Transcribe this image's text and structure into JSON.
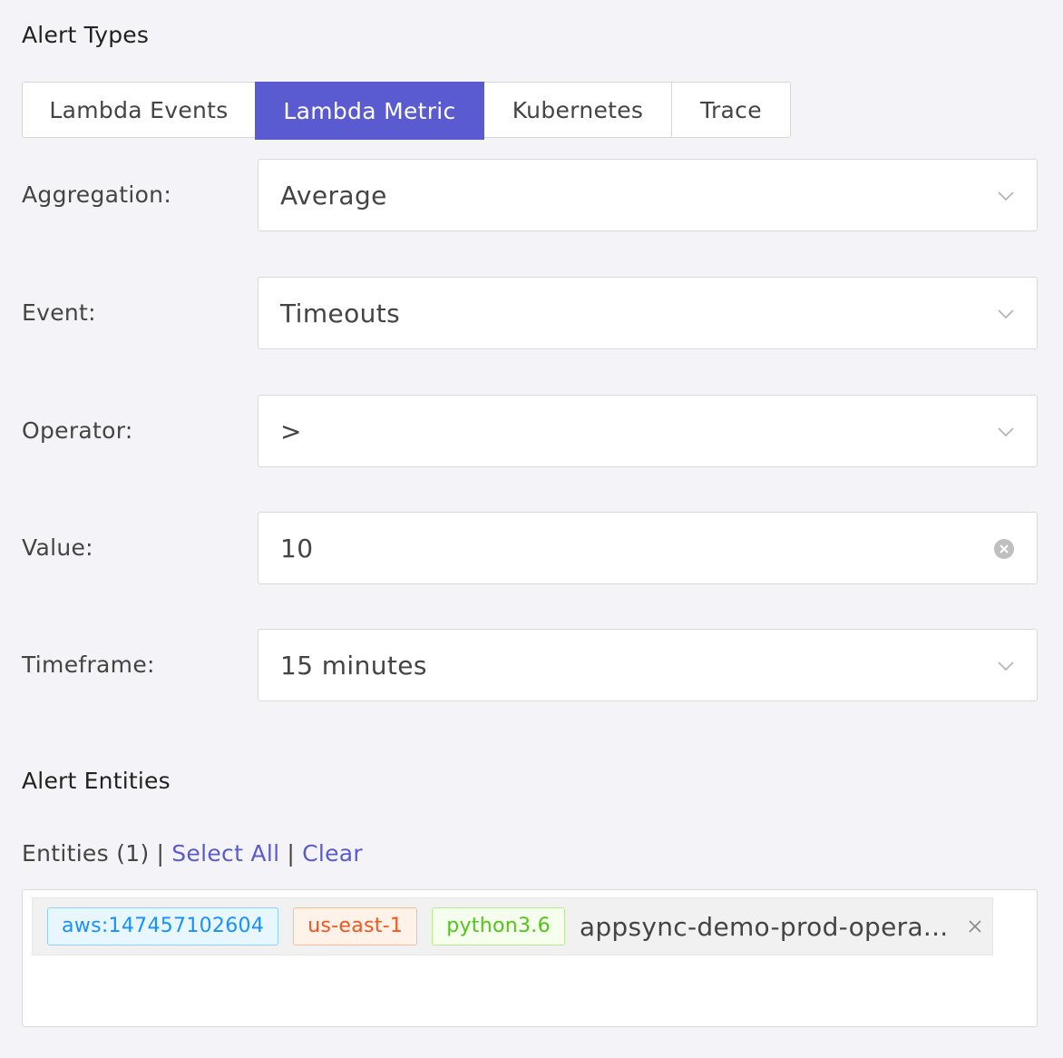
{
  "alert_types": {
    "title": "Alert Types",
    "tabs": [
      {
        "label": "Lambda Events",
        "active": false
      },
      {
        "label": "Lambda Metric",
        "active": true
      },
      {
        "label": "Kubernetes",
        "active": false
      },
      {
        "label": "Trace",
        "active": false
      }
    ]
  },
  "form": {
    "aggregation": {
      "label": "Aggregation:",
      "value": "Average"
    },
    "event": {
      "label": "Event:",
      "value": "Timeouts"
    },
    "operator": {
      "label": "Operator:",
      "value": ">"
    },
    "value": {
      "label": "Value:",
      "value": "10"
    },
    "timeframe": {
      "label": "Timeframe:",
      "value": "15 minutes"
    }
  },
  "alert_entities": {
    "title": "Alert Entities",
    "count_label": "Entities (1)",
    "separator": "|",
    "select_all": "Select All",
    "clear": "Clear",
    "items": [
      {
        "tags": [
          "aws:147457102604",
          "us-east-1",
          "python3.6"
        ],
        "name": "appsync-demo-prod-opera..."
      }
    ]
  },
  "colors": {
    "accent": "#5a5bd0",
    "tag_blue": "#1890ff",
    "tag_orange": "#fa541c",
    "tag_green": "#52c41a"
  },
  "icons": {
    "dropdown": "chevron-down-icon",
    "clear": "clear-circle-icon",
    "remove": "close-icon"
  }
}
